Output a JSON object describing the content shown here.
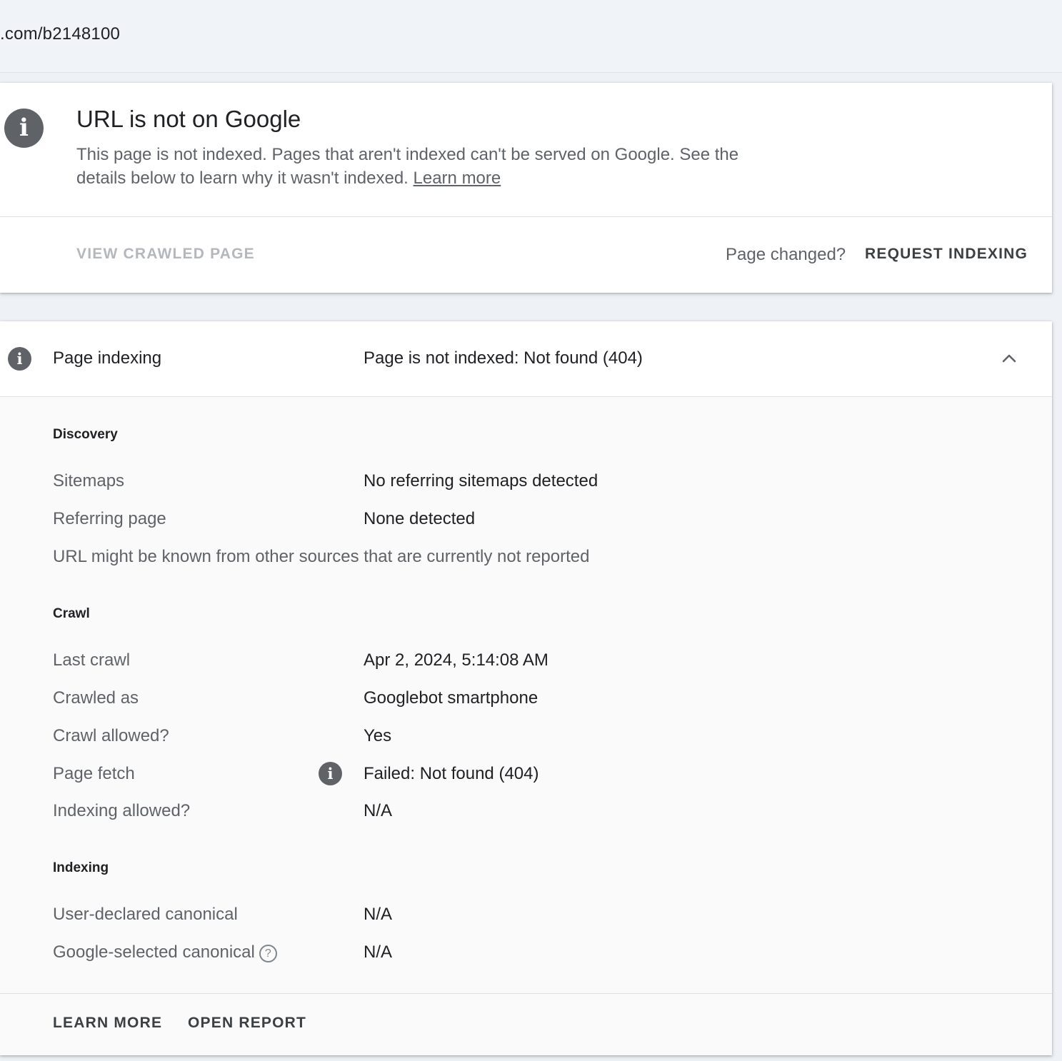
{
  "url_bar": {
    "url": ".com/b2148100"
  },
  "status_card": {
    "icon": "info-icon",
    "title": "URL is not on Google",
    "description": "This page is not indexed. Pages that aren't indexed can't be served on Google. See the details below to learn why it wasn't indexed.",
    "learn_more_link": "Learn more",
    "view_crawled_page_label": "VIEW CRAWLED PAGE",
    "page_changed_text": "Page changed?",
    "request_indexing_label": "REQUEST INDEXING"
  },
  "indexing_card": {
    "icon": "info-icon",
    "label": "Page indexing",
    "value": "Page is not indexed: Not found (404)",
    "toggle_icon": "chevron-up-icon",
    "discovery": {
      "title": "Discovery",
      "rows": [
        {
          "label": "Sitemaps",
          "value": "No referring sitemaps detected"
        },
        {
          "label": "Referring page",
          "value": "None detected"
        }
      ],
      "note": "URL might be known from other sources that are currently not reported"
    },
    "crawl": {
      "title": "Crawl",
      "rows": [
        {
          "label": "Last crawl",
          "value": "Apr 2, 2024, 5:14:08 AM"
        },
        {
          "label": "Crawled as",
          "value": "Googlebot smartphone"
        },
        {
          "label": "Crawl allowed?",
          "value": "Yes"
        },
        {
          "label": "Page fetch",
          "value": "Failed: Not found (404)",
          "icon": "info-icon"
        },
        {
          "label": "Indexing allowed?",
          "value": "N/A"
        }
      ]
    },
    "indexing": {
      "title": "Indexing",
      "rows": [
        {
          "label": "User-declared canonical",
          "value": "N/A"
        },
        {
          "label": "Google-selected canonical",
          "value": "N/A",
          "icon": "help-icon",
          "icon_glyph": "?"
        }
      ]
    },
    "footer": {
      "learn_more_label": "LEARN MORE",
      "open_report_label": "OPEN REPORT"
    }
  },
  "colors": {
    "page_background": "#eef2f7",
    "card_background": "#ffffff",
    "detail_background": "#fafafa",
    "icon_gray": "#5f6368",
    "muted_text": "#5f6368",
    "disabled_text": "#b4b8bd"
  }
}
